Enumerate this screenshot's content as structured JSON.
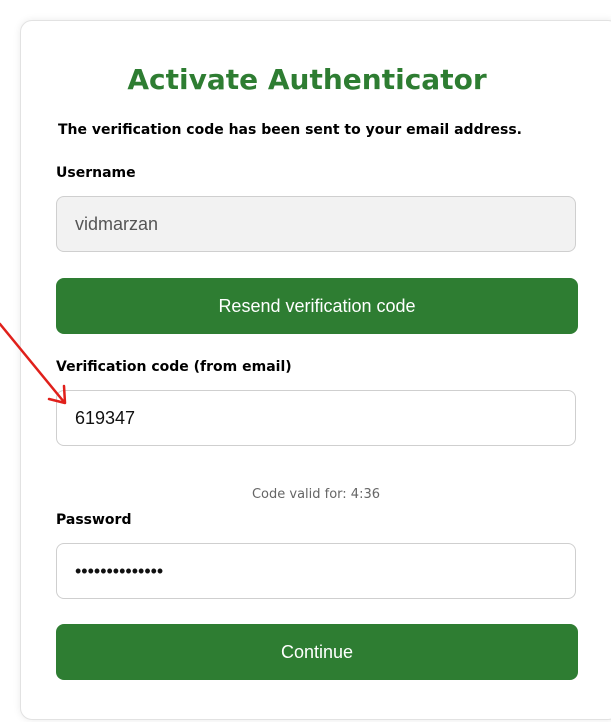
{
  "form": {
    "title": "Activate Authenticator",
    "subtitle": "The verification code has been sent to your email address.",
    "username_label": "Username",
    "username_value": "vidmarzan",
    "resend_button": "Resend verification code",
    "code_label": "Verification code (from email)",
    "code_value": "619347",
    "code_validity": "Code valid for: 4:36",
    "password_label": "Password",
    "password_value": "••••••••••••••",
    "continue_button": "Continue"
  },
  "annotation": {
    "arrow_color": "#e0201b"
  },
  "colors": {
    "accent": "#2e7d32",
    "readonly_bg": "#f2f2f2"
  }
}
